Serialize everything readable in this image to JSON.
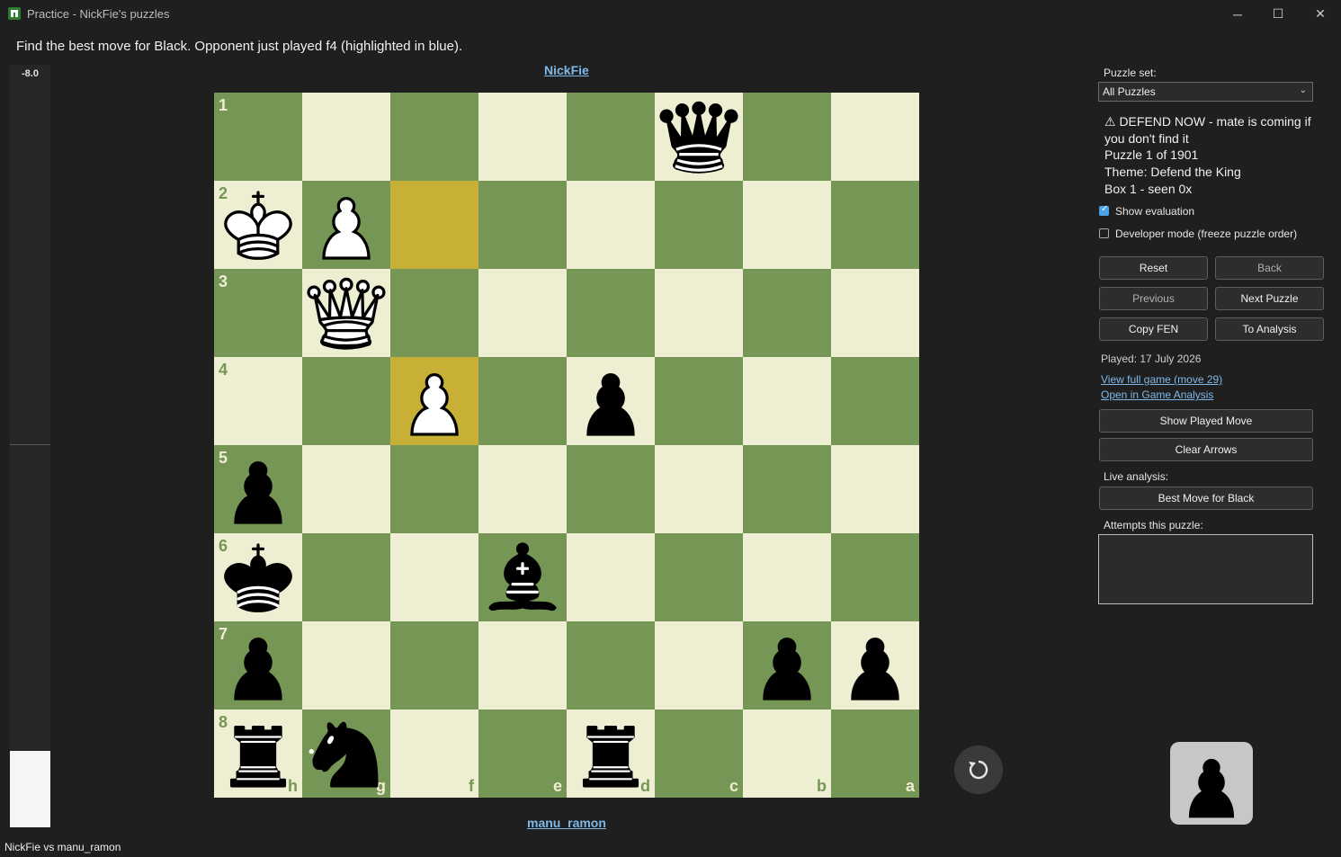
{
  "window": {
    "title": "Practice - NickFie's puzzles",
    "minimize": "─",
    "maximize": "☐",
    "close": "✕"
  },
  "instruction": "Find the best move for Black. Opponent just played f4 (highlighted in blue).",
  "evaluation": {
    "value": "-8.0",
    "white_fraction": 0.1
  },
  "players": {
    "top": "NickFie",
    "bottom": "manu_ramon"
  },
  "board": {
    "orientation": "black",
    "colors": {
      "light": "#eeeed2",
      "dark": "#769656",
      "highlight": "#c8b036"
    },
    "ranks": [
      "1",
      "2",
      "3",
      "4",
      "5",
      "6",
      "7",
      "8"
    ],
    "files": [
      "h",
      "g",
      "f",
      "e",
      "d",
      "c",
      "b",
      "a"
    ],
    "highlighted_squares": [
      "f2",
      "f4"
    ],
    "pieces": [
      {
        "square": "c1",
        "piece": "queen",
        "color": "black"
      },
      {
        "square": "h2",
        "piece": "king",
        "color": "white"
      },
      {
        "square": "g2",
        "piece": "pawn",
        "color": "white"
      },
      {
        "square": "g3",
        "piece": "queen",
        "color": "white"
      },
      {
        "square": "f4",
        "piece": "pawn",
        "color": "white"
      },
      {
        "square": "d4",
        "piece": "pawn",
        "color": "black"
      },
      {
        "square": "h5",
        "piece": "pawn",
        "color": "black"
      },
      {
        "square": "h6",
        "piece": "king",
        "color": "black"
      },
      {
        "square": "e6",
        "piece": "bishop",
        "color": "black"
      },
      {
        "square": "h7",
        "piece": "pawn",
        "color": "black"
      },
      {
        "square": "b7",
        "piece": "pawn",
        "color": "black"
      },
      {
        "square": "a7",
        "piece": "pawn",
        "color": "black"
      },
      {
        "square": "h8",
        "piece": "rook",
        "color": "black"
      },
      {
        "square": "g8",
        "piece": "knight",
        "color": "black"
      },
      {
        "square": "d8",
        "piece": "rook",
        "color": "black"
      }
    ]
  },
  "panel": {
    "puzzle_set_label": "Puzzle set:",
    "puzzle_set_value": "All Puzzles",
    "warning": "⚠ DEFEND NOW - mate is coming if you don't find it",
    "puzzle_count": "Puzzle 1 of 1901",
    "theme": "Theme: Defend the King",
    "box": "Box 1 - seen 0x",
    "show_evaluation": {
      "label": "Show evaluation",
      "checked": true
    },
    "developer_mode": {
      "label": "Developer mode (freeze puzzle order)",
      "checked": false
    },
    "buttons": {
      "reset": "Reset",
      "back": "Back",
      "previous": "Previous",
      "next": "Next Puzzle",
      "copy_fen": "Copy FEN",
      "to_analysis": "To Analysis",
      "show_played": "Show Played Move",
      "clear_arrows": "Clear Arrows",
      "best_move": "Best Move for Black"
    },
    "played": "Played: 17 July 2026",
    "link_full_game": "View full game (move 29)",
    "link_game_analysis": "Open in Game Analysis",
    "live_analysis_label": "Live analysis:",
    "attempts_label": "Attempts this puzzle:"
  },
  "turn_indicator": {
    "side": "black",
    "piece": "pawn"
  },
  "status": "NickFie vs manu_ramon"
}
